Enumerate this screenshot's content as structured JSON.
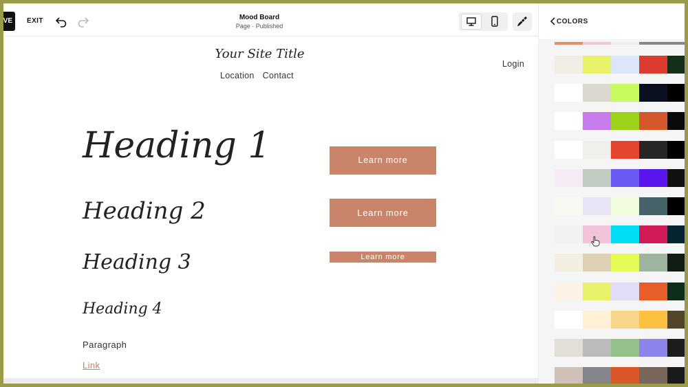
{
  "toolbar": {
    "save_label": "VE",
    "exit_label": "EXIT",
    "doc_title": "Mood Board",
    "doc_status": "Page · Published"
  },
  "site": {
    "title": "Your Site Title",
    "nav": [
      "Location",
      "Contact"
    ],
    "login": "Login"
  },
  "content": {
    "heading1": "Heading 1",
    "heading2": "Heading 2",
    "heading3": "Heading 3",
    "heading4": "Heading 4",
    "paragraph": "Paragraph",
    "link": "Link",
    "buttons": [
      "Learn more",
      "Learn more",
      "Learn more"
    ]
  },
  "panel": {
    "title": "COLORS",
    "top_strip": [
      "#e98b6f",
      "#f3c8d0",
      "#eeeeee",
      "#888888"
    ],
    "palettes": [
      [
        "#f0ede5",
        "#e9f16b",
        "#dbe6f8",
        "#dd3b2f",
        "#153019"
      ],
      [
        "#ffffff",
        "#dbd8d0",
        "#c8fb60",
        "#0b1020",
        "#000000"
      ],
      [
        "#ffffff",
        "#c87ded",
        "#9bd21a",
        "#d4582c",
        "#0a0a0a"
      ],
      [
        "#ffffff",
        "#efefec",
        "#e4462d",
        "#262626",
        "#000000"
      ],
      [
        "#f6ecf6",
        "#c1cdc3",
        "#6b5bf4",
        "#5a16ec",
        "#111111"
      ],
      [
        "#f9f8f3",
        "#e8e4f6",
        "#f0fcdc",
        "#456268",
        "#000000"
      ],
      [
        "#f2f2f2",
        "#f3c4d9",
        "#00ddf3",
        "#d21a58",
        "#052630"
      ],
      [
        "#f2efe1",
        "#ded1b4",
        "#e5fb56",
        "#9fb49e",
        "#131c14"
      ],
      [
        "#fdf2e6",
        "#e9f16b",
        "#e1dcf8",
        "#e85e2a",
        "#0e2e1b"
      ],
      [
        "#ffffff",
        "#fff1d6",
        "#f7d58b",
        "#fcc13e",
        "#51452a"
      ],
      [
        "#e2dfd8",
        "#bbbbbb",
        "#94c08a",
        "#8d83ec",
        "#1c1c1c"
      ],
      [
        "#cfc1b8",
        "#85838b",
        "#db5628",
        "#79665a",
        "#1a1a1a"
      ]
    ]
  }
}
